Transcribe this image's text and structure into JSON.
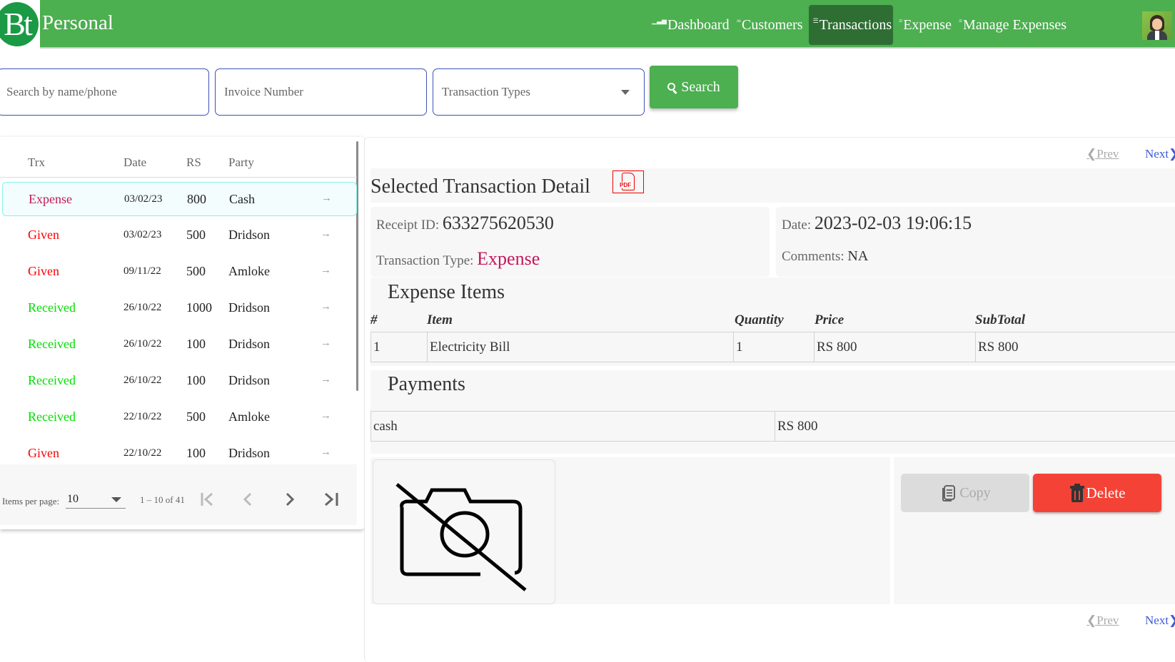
{
  "header": {
    "logo_text": "Bt",
    "brand": "Personal",
    "nav": [
      {
        "label": "Dashboard",
        "icon": "bar-chart-icon",
        "glyph": "▁▃▅",
        "active": false
      },
      {
        "label": "Customers",
        "icon": "users-icon",
        "glyph": "∞",
        "active": false
      },
      {
        "label": "Transactions",
        "icon": "list-icon",
        "glyph": "☰",
        "active": true
      },
      {
        "label": "Expense",
        "icon": "list-icon",
        "glyph": "≡",
        "active": false
      },
      {
        "label": "Manage Expenses",
        "icon": "list-icon",
        "glyph": "≡",
        "active": false
      }
    ],
    "avatar": "user-avatar"
  },
  "search": {
    "name_placeholder": "Search by name/phone",
    "name_value": "",
    "invoice_placeholder": "Invoice Number",
    "invoice_value": "",
    "type_placeholder": "Transaction Types",
    "button_label": "Search"
  },
  "list": {
    "columns": [
      "Trx",
      "Date",
      "RS",
      "Party"
    ],
    "rows": [
      {
        "type": "Expense",
        "date": "03/02/23",
        "amount": "800",
        "party": "Cash",
        "color": "#c2185b",
        "selected": true
      },
      {
        "type": "Given",
        "date": "03/02/23",
        "amount": "500",
        "party": "Dridson",
        "color": "#ff0000",
        "selected": false
      },
      {
        "type": "Given",
        "date": "09/11/22",
        "amount": "500",
        "party": "Amloke",
        "color": "#ff0000",
        "selected": false
      },
      {
        "type": "Received",
        "date": "26/10/22",
        "amount": "1000",
        "party": "Dridson",
        "color": "#00e000",
        "selected": false
      },
      {
        "type": "Received",
        "date": "26/10/22",
        "amount": "100",
        "party": "Dridson",
        "color": "#00e000",
        "selected": false
      },
      {
        "type": "Received",
        "date": "26/10/22",
        "amount": "100",
        "party": "Dridson",
        "color": "#00e000",
        "selected": false
      },
      {
        "type": "Received",
        "date": "22/10/22",
        "amount": "500",
        "party": "Amloke",
        "color": "#00e000",
        "selected": false
      },
      {
        "type": "Given",
        "date": "22/10/22",
        "amount": "100",
        "party": "Dridson",
        "color": "#ff0000",
        "selected": false
      }
    ],
    "row_arrow": "→",
    "paginator": {
      "items_per_page_label": "Items per page:",
      "items_per_page": "10",
      "range": "1 – 10 of 41"
    }
  },
  "detail": {
    "prev_label": "❮Prev",
    "next_label": "Next❯",
    "title": "Selected Transaction Detail",
    "pdf_label": "PDF",
    "receipt_label": "Receipt ID:",
    "receipt_id": "633275620530",
    "type_label": "Transaction Type:",
    "type_value": "Expense",
    "date_label": "Date:",
    "date_value": "2023-02-03 19:06:15",
    "comments_label": "Comments:",
    "comments_value": "NA",
    "items_title": "Expense Items",
    "items_columns": [
      "#",
      "Item",
      "Quantity",
      "Price",
      "SubTotal"
    ],
    "items": [
      {
        "no": "1",
        "item": "Electricity Bill",
        "qty": "1",
        "price": "RS 800",
        "subtotal": "RS 800"
      }
    ],
    "payments_title": "Payments",
    "payments": [
      {
        "method": "cash",
        "amount": "RS 800"
      }
    ],
    "copy_label": "Copy",
    "delete_label": "Delete",
    "colors": {
      "expense": "#c2185b",
      "delete": "#f44336",
      "brand": "#4caf50"
    }
  }
}
